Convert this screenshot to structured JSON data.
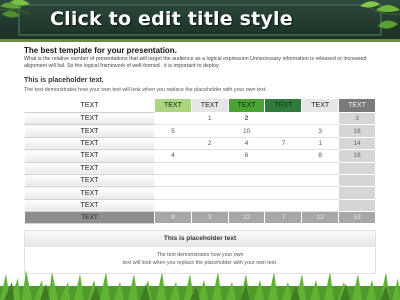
{
  "slide": {
    "title": "Click to edit title style",
    "intro_heading": "The best template for your presentation.",
    "intro_text": "What is the relative number of presentations that will target the audience as a logical expression Unnecessary information is released or increased alignment will fail. So the logical framework of well-formed , it is important to deploy.",
    "placeholder_heading": "This is placeholder text.",
    "placeholder_text": "The text demonstrates how your own text will look when you replace the placeholder with your own text."
  },
  "table": {
    "header": [
      "TEXT",
      "TEXT",
      "TEXT",
      "TEXT",
      "TEXT",
      "TEXT",
      "TEXT"
    ],
    "header_colors": [
      "#ffffff",
      "#a9d67e",
      "#e6e6e6",
      "#4aa332",
      "#2f7a3c",
      "#e6e6e6",
      "#7a7a7a"
    ],
    "rows": [
      [
        "TEXT",
        "",
        "1",
        "2",
        "",
        "",
        "3"
      ],
      [
        "TEXT",
        "5",
        "",
        "10",
        "",
        "3",
        "18"
      ],
      [
        "TEXT",
        "",
        "2",
        "4",
        "7",
        "1",
        "14"
      ],
      [
        "TEXT",
        "4",
        "",
        "6",
        "",
        "8",
        "18"
      ],
      [
        "TEXT",
        "",
        "",
        "",
        "",
        "",
        ""
      ],
      [
        "TEXT",
        "",
        "",
        "",
        "",
        "",
        ""
      ],
      [
        "TEXT",
        "",
        "",
        "",
        "",
        "",
        ""
      ],
      [
        "TEXT",
        "",
        "",
        "",
        "",
        "",
        ""
      ]
    ],
    "footer": [
      "TEXT",
      "9",
      "3",
      "22",
      "7",
      "12",
      "53"
    ]
  },
  "box": {
    "title": "This is placeholder text",
    "text_line1": "The text demonstrates how your own",
    "text_line2": "text will look when you replace the placeholder with your own text."
  },
  "colors": {
    "header_board": "#223a30",
    "accent_green": "#6b8c3a"
  }
}
